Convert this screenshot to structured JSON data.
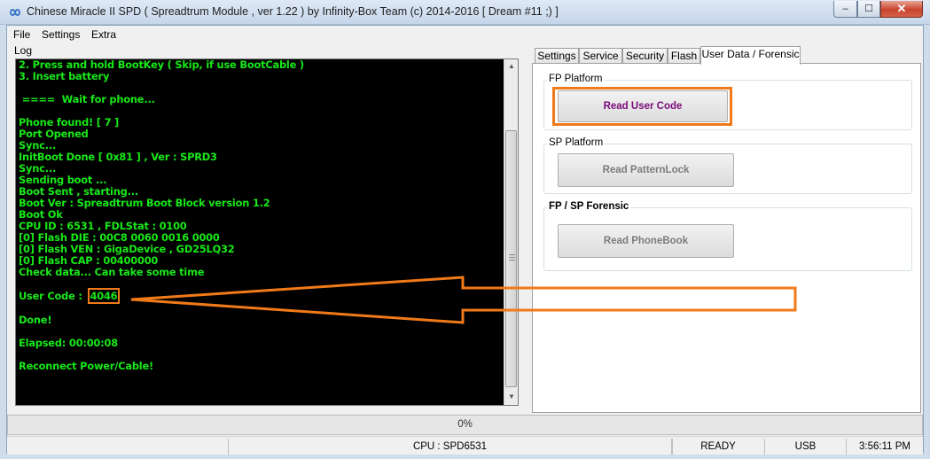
{
  "window": {
    "title": "Chinese Miracle II SPD ( Spreadtrum Module , ver 1.22 ) by Infinity-Box Team (c) 2014-2016 [ Dream #11 ;) ]",
    "minimize_glyph": "–",
    "maximize_glyph": "☐",
    "close_glyph": "✕"
  },
  "menu": [
    "File",
    "Settings",
    "Extra"
  ],
  "log": {
    "label": "Log",
    "lines": [
      "2. Press and hold BootKey ( Skip, if use BootCable )",
      "3. Insert battery",
      "",
      " ====  Wait for phone...",
      "",
      "Phone found! [ 7 ]",
      "Port Opened",
      "Sync...",
      "InitBoot Done [ 0x81 ] , Ver : SPRD3",
      "Sync...",
      "Sending boot ...",
      "Boot Sent , starting...",
      "Boot Ver : Spreadtrum Boot Block version 1.2",
      "Boot Ok",
      "CPU ID : 6531 , FDLStat : 0100",
      "[0] Flash DIE : 00C8 0060 0016 0000",
      "[0] Flash VEN : GigaDevice , GD25LQ32",
      "[0] Flash CAP : 00400000",
      "Check data... Can take some time",
      ""
    ],
    "user_code_label": "User Code : ",
    "user_code_value": "4046",
    "after_lines": [
      "",
      "Done!",
      "",
      "Elapsed: 00:00:08",
      "",
      "Reconnect Power/Cable!"
    ],
    "scroll_up_glyph": "▲",
    "scroll_down_glyph": "▼"
  },
  "tabs": [
    {
      "label": "Settings",
      "active": false
    },
    {
      "label": "Service",
      "active": false
    },
    {
      "label": "Security",
      "active": false
    },
    {
      "label": "Flash",
      "active": false
    },
    {
      "label": "User Data / Forensic",
      "active": true
    }
  ],
  "panel": {
    "fp_platform": {
      "title": "FP Platform",
      "button": "Read User Code",
      "enabled": true
    },
    "sp_platform": {
      "title": "SP Platform",
      "button": "Read PatternLock",
      "enabled": false
    },
    "forensic": {
      "title": "FP / SP Forensic",
      "button": "Read PhoneBook",
      "enabled": false
    }
  },
  "progress": {
    "value": 0,
    "text": "0%"
  },
  "status": {
    "panel1": "",
    "cpu": "CPU : SPD6531",
    "panel3": "",
    "state": "READY",
    "connection": "USB",
    "time": "3:56:11 PM"
  },
  "colors": {
    "log_text": "#18e818",
    "annotation": "#f07a1a",
    "accent_button_text": "#7a0a7a"
  },
  "icons": {
    "app": "infinity-icon",
    "arrow": "annotation-arrow"
  }
}
